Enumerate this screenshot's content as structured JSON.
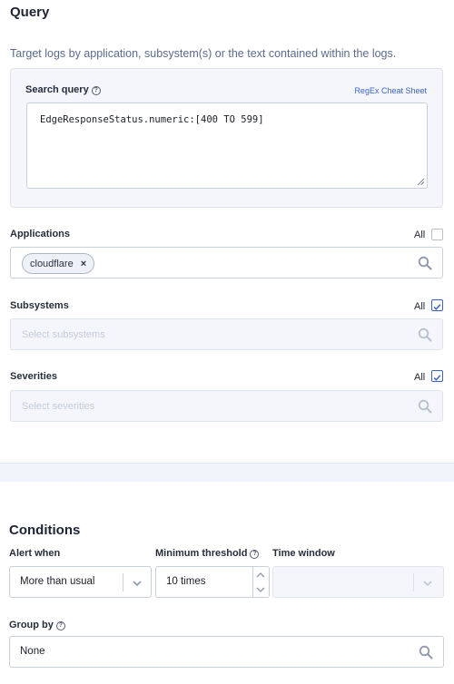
{
  "query": {
    "title": "Query",
    "description": "Target logs by application, subsystem(s) or the text contained within the logs.",
    "search_query_label": "Search query",
    "help_glyph": "?",
    "regex_link": "RegEx Cheat Sheet",
    "search_query_value": "EdgeResponseStatus.numeric:[400 TO 599]"
  },
  "applications": {
    "label": "Applications",
    "all_label": "All",
    "all_checked": false,
    "chips": [
      "cloudflare"
    ],
    "chip_remove": "×"
  },
  "subsystems": {
    "label": "Subsystems",
    "all_label": "All",
    "all_checked": true,
    "placeholder": "Select subsystems"
  },
  "severities": {
    "label": "Severities",
    "all_label": "All",
    "all_checked": true,
    "placeholder": "Select severities"
  },
  "conditions": {
    "title": "Conditions",
    "alert_when_label": "Alert when",
    "alert_when_value": "More than usual",
    "min_threshold_label": "Minimum threshold",
    "min_threshold_value": "10 times",
    "time_window_label": "Time window",
    "time_window_value": "",
    "group_by_label": "Group by",
    "group_by_value": "None"
  },
  "icons": {
    "search": "search-icon",
    "help": "help-icon",
    "chevron": "chevron-down-icon",
    "check": "check-icon"
  },
  "colors": {
    "accent": "#3a63c8",
    "panel": "#f4f6fb",
    "border": "#c9cfdb"
  }
}
